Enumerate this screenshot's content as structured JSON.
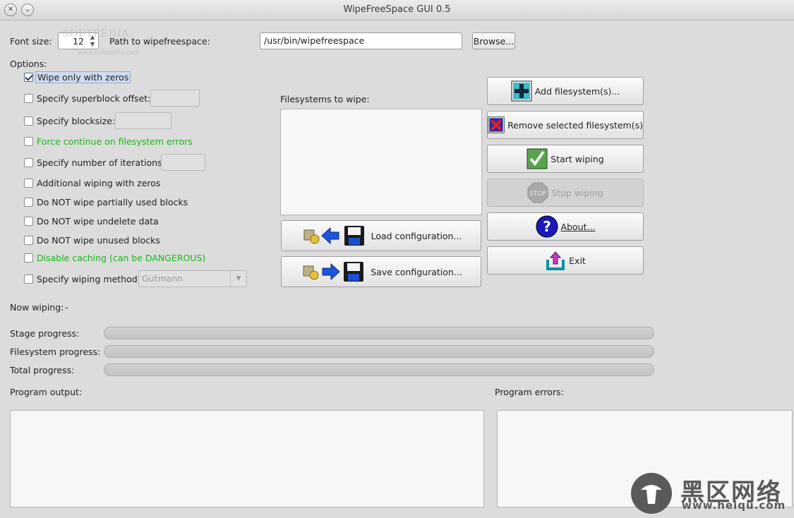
{
  "window": {
    "title": "WipeFreeSpace GUI 0.5"
  },
  "top": {
    "font_size_label": "Font size:",
    "font_size_value": "12",
    "path_label": "Path to wipefreespace:",
    "path_value": "/usr/bin/wipefreespace",
    "browse_label": "Browse..."
  },
  "options": {
    "heading": "Options:",
    "items": [
      {
        "label": "Wipe only with zeros",
        "checked": true
      },
      {
        "label": "Specify superblock offset:",
        "checked": false
      },
      {
        "label": "Specify blocksize:",
        "checked": false
      },
      {
        "label": "Force continue on filesystem errors",
        "checked": false,
        "color": "#1bb51b"
      },
      {
        "label": "Specify number of iterations:",
        "checked": false
      },
      {
        "label": "Additional wiping with zeros",
        "checked": false
      },
      {
        "label": "Do NOT wipe partially used blocks",
        "checked": false
      },
      {
        "label": "Do NOT wipe undelete data",
        "checked": false
      },
      {
        "label": "Do NOT wipe unused blocks",
        "checked": false
      },
      {
        "label": "Disable caching (can be DANGEROUS)",
        "checked": false,
        "color": "#1bb51b"
      },
      {
        "label": "Specify wiping method:",
        "checked": false
      }
    ],
    "wiping_method_value": "Gutmann"
  },
  "filesystems": {
    "heading": "Filesystems to wipe:",
    "load_label": "Load configuration...",
    "save_label": "Save configuration..."
  },
  "actions": {
    "add": "Add filesystem(s)...",
    "remove": "Remove selected filesystem(s)",
    "start": "Start wiping",
    "stop": "Stop wiping",
    "stop_icon_text": "STOP",
    "about": "About...",
    "exit": "Exit"
  },
  "status": {
    "now_wiping_label": "Now wiping:",
    "now_wiping_value": "-",
    "stage_label": "Stage progress:",
    "filesystem_label": "Filesystem progress:",
    "total_label": "Total progress:",
    "stage_progress": 0,
    "filesystem_progress": 0,
    "total_progress": 0
  },
  "output": {
    "program_output_label": "Program output:",
    "program_errors_label": "Program errors:"
  },
  "watermarks": {
    "softpedia": "SOFTPEDIA",
    "softpedia_url": "www.softpedia.com",
    "heiqu_cn": "黑区网络",
    "heiqu_url": "www.heiqu.com"
  },
  "colors": {
    "green_option": "#1bb51b",
    "panel_bg": "#f7f7f7",
    "window_bg": "#dcdcdc"
  }
}
